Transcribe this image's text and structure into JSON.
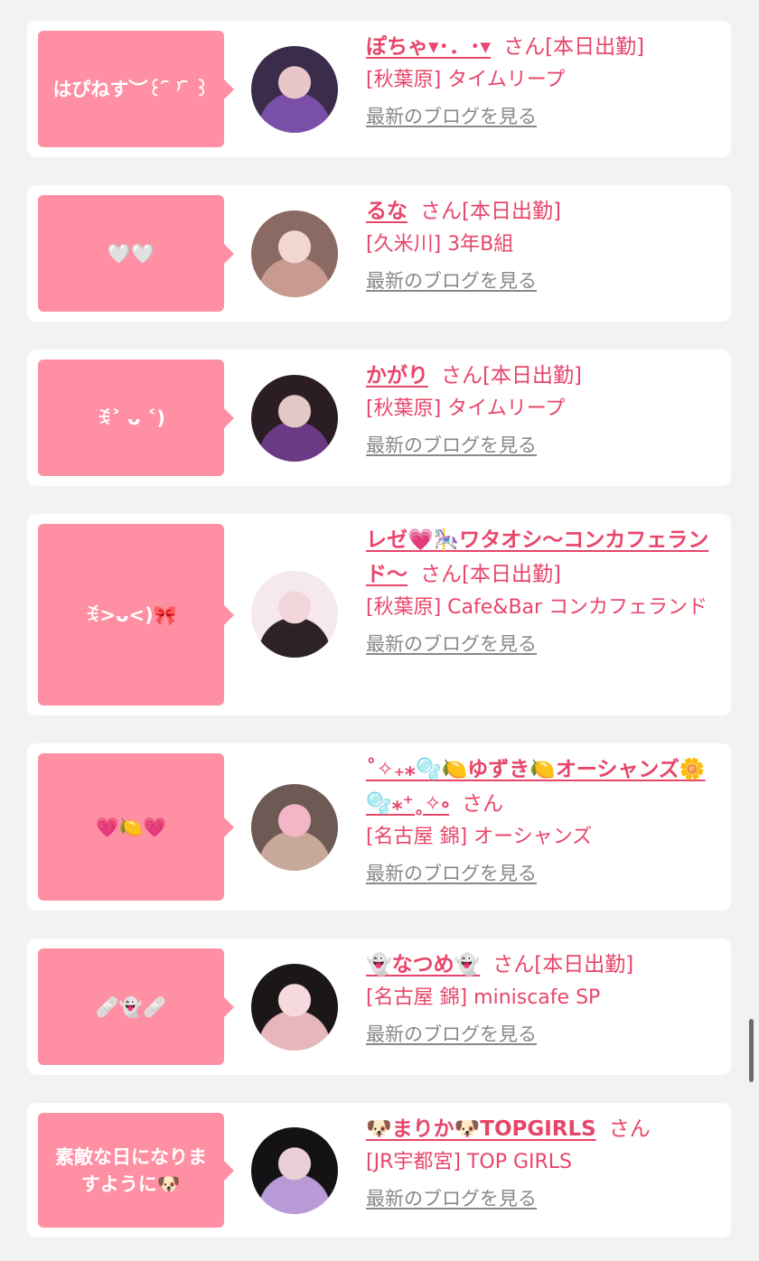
{
  "colors": {
    "accent": "#e8456a",
    "bubble": "#ff8fa3",
    "link_gray": "#888888"
  },
  "entries": [
    {
      "bubble": "はぴねす︶꒰ ᷇ ⁾ ᷇ ꒱",
      "name": "ぽちゃ▾･．･▾",
      "suffix": "さん[本日出勤]",
      "shop": "[秋葉原] タイムリープ",
      "blog": "最新のブログを見る",
      "avatar_colors": [
        "#3a2c4a",
        "#7a4fa8",
        "#e9c7c9"
      ]
    },
    {
      "bubble": "🤍🤍",
      "name": "るな",
      "suffix": "さん[本日出勤]",
      "shop": "[久米川] 3年B組",
      "blog": "最新のブログを見る",
      "avatar_colors": [
        "#8a6a62",
        "#c79b8f",
        "#f1d7cf"
      ]
    },
    {
      "bubble": "ꉂ˃ ᴗ ˂)",
      "name": "かがり",
      "suffix": "さん[本日出勤]",
      "shop": "[秋葉原] タイムリープ",
      "blog": "最新のブログを見る",
      "avatar_colors": [
        "#2a1d24",
        "#6b3a85",
        "#e4c8c6"
      ]
    },
    {
      "bubble": "ꉂ>ᴗ<)🎀",
      "name": "レゼ💗🎠ワタオシ〜コンカフェランド〜",
      "suffix": "さん[本日出勤]",
      "shop": "[秋葉原] Cafe&Bar コンカフェランド",
      "blog": "最新のブログを見る",
      "avatar_colors": [
        "#f6e9ee",
        "#2d2228",
        "#f2d6dc"
      ]
    },
    {
      "bubble": "💗🍋💗",
      "name": "˚✧₊⁎🫧🍋ゆずき🍋オーシャンズ🌼🫧⁎⁺˳✧༚",
      "suffix": "さん",
      "shop": "[名古屋 錦] オーシャンズ",
      "blog": "最新のブログを見る",
      "avatar_colors": [
        "#6e5a55",
        "#c9a89c",
        "#f3b6c6"
      ]
    },
    {
      "bubble": "🩹👻🩹",
      "name": "👻なつめ👻",
      "suffix": "さん[本日出勤]",
      "shop": "[名古屋 錦] miniscafe SP",
      "blog": "最新のブログを見る",
      "avatar_colors": [
        "#1b1719",
        "#e7b6bd",
        "#f6d9dc"
      ]
    },
    {
      "bubble": "素敵な日になりますように🐶",
      "name": "🐶まりか🐶TOPGIRLS",
      "suffix": "さん",
      "shop": "[JR宇都宮] TOP GIRLS",
      "blog": "最新のブログを見る",
      "avatar_colors": [
        "#151216",
        "#b79ad6",
        "#ead0d6"
      ]
    }
  ]
}
